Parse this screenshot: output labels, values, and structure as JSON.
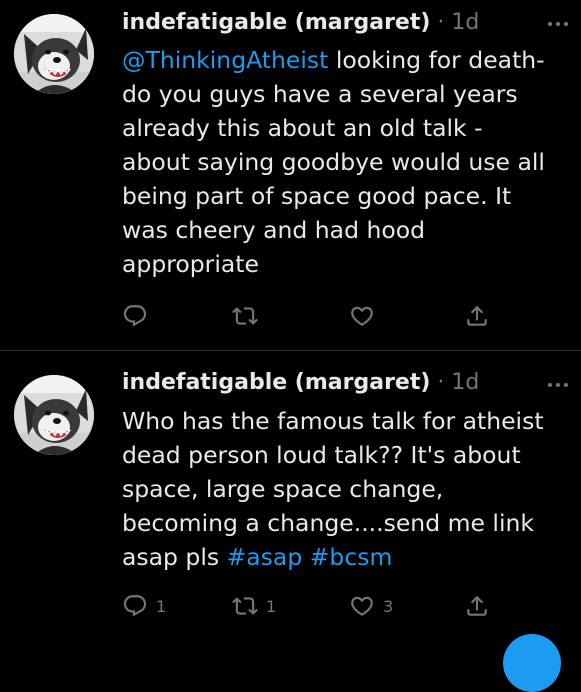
{
  "colors": {
    "background": "#000000",
    "text": "#e7e9ea",
    "muted": "#71767b",
    "accent": "#1d9bf0",
    "divider": "#2f3336"
  },
  "tweets": [
    {
      "display_name": "indefatigable (margaret)",
      "time": "· 1d",
      "more_icon": "more-dots-icon",
      "mention": "@ThinkingAtheist",
      "text": " looking for death-\ndo you guys have a several years\nalready this about an old talk -\nabout saying goodbye would use all\nbeing part of space  good pace. It\nwas cheery and had hood\nappropriate",
      "hashtags": [],
      "actions": {
        "reply": {
          "icon": "reply-icon",
          "count": ""
        },
        "retweet": {
          "icon": "retweet-icon",
          "count": ""
        },
        "like": {
          "icon": "heart-icon",
          "count": ""
        },
        "share": {
          "icon": "share-icon"
        }
      }
    },
    {
      "display_name": "indefatigable (margaret)",
      "time": "· 1d",
      "more_icon": "more-dots-icon",
      "text": "Who has the famous talk for atheist\ndead person loud talk?? It's about\nspace, large space change,\nbecoming a change....send me link\nasap pls ",
      "hashtags": [
        "#asap",
        "#bcsm"
      ],
      "actions": {
        "reply": {
          "icon": "reply-icon",
          "count": "1"
        },
        "retweet": {
          "icon": "retweet-icon",
          "count": "1"
        },
        "like": {
          "icon": "heart-icon",
          "count": "3"
        },
        "share": {
          "icon": "share-icon"
        }
      }
    }
  ]
}
